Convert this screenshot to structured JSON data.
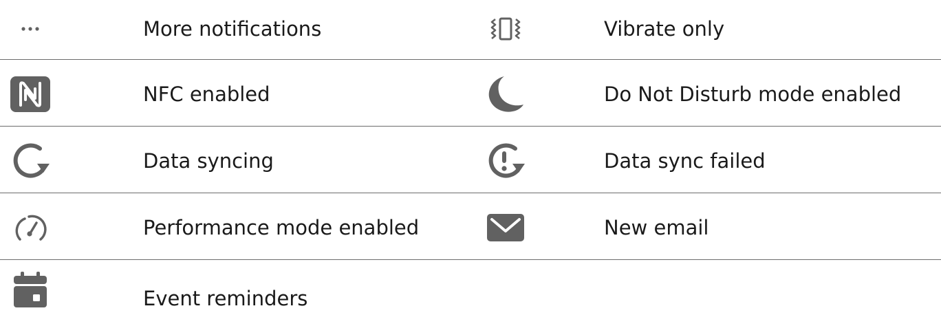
{
  "rows": [
    {
      "left": {
        "icon": "more-icon",
        "label": "More notifications"
      },
      "right": {
        "icon": "vibrate-icon",
        "label": "Vibrate only"
      }
    },
    {
      "left": {
        "icon": "nfc-icon",
        "label": "NFC enabled"
      },
      "right": {
        "icon": "moon-icon",
        "label": "Do Not Disturb mode enabled"
      }
    },
    {
      "left": {
        "icon": "sync-icon",
        "label": "Data syncing"
      },
      "right": {
        "icon": "sync-failed-icon",
        "label": "Data sync failed"
      }
    },
    {
      "left": {
        "icon": "speedometer-icon",
        "label": "Performance mode enabled"
      },
      "right": {
        "icon": "email-icon",
        "label": "New email"
      }
    },
    {
      "left": {
        "icon": "calendar-icon",
        "label": "Event reminders"
      }
    }
  ],
  "colors": {
    "icon": "#616161",
    "divider": "#6b6b6b",
    "text": "#1a1a1a"
  }
}
